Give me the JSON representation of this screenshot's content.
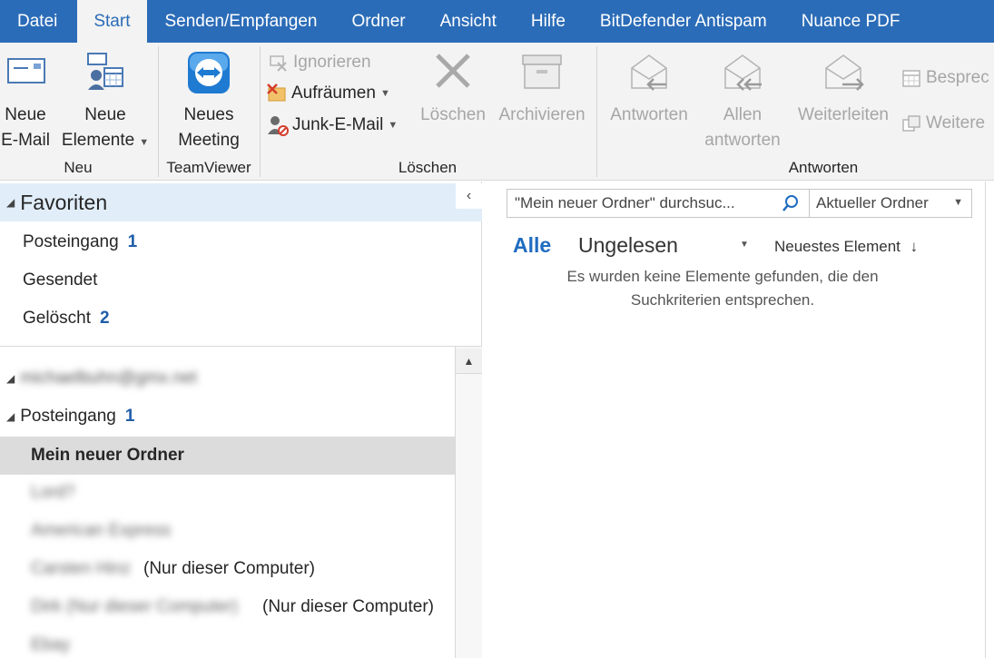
{
  "tabs": [
    "Datei",
    "Start",
    "Senden/Empfangen",
    "Ordner",
    "Ansicht",
    "Hilfe",
    "BitDefender Antispam",
    "Nuance PDF"
  ],
  "ribbon": {
    "neu": {
      "new_mail": [
        "Neue",
        "E-Mail"
      ],
      "new_items": [
        "Neue",
        "Elemente"
      ],
      "group": "Neu"
    },
    "teamviewer": {
      "meeting": [
        "Neues",
        "Meeting"
      ],
      "group": "TeamViewer"
    },
    "loeschen": {
      "ignore": "Ignorieren",
      "cleanup": "Aufräumen",
      "junk": "Junk-E-Mail",
      "delete": "Löschen",
      "archive": "Archivieren",
      "group": "Löschen"
    },
    "antworten": {
      "reply": "Antworten",
      "reply_all": [
        "Allen",
        "antworten"
      ],
      "forward": "Weiterleiten",
      "meeting": "Besprec",
      "more": "Weitere",
      "group": "Antworten"
    }
  },
  "nav": {
    "favorites_title": "Favoriten",
    "favorites": [
      {
        "label": "Posteingang",
        "count": "1"
      },
      {
        "label": "Gesendet",
        "count": ""
      },
      {
        "label": "Gelöscht",
        "count": "2"
      }
    ],
    "account": "michaelbuhn@gmx.net",
    "inbox": {
      "label": "Posteingang",
      "count": "1"
    },
    "selected_folder": "Mein neuer Ordner",
    "subfolders": [
      {
        "name": "Lord?",
        "suffix": ""
      },
      {
        "name": "American Express",
        "suffix": ""
      },
      {
        "name": "Carsten Hinz",
        "suffix": "(Nur dieser Computer)"
      },
      {
        "name": "Dirk (Nur dieser Computer)",
        "suffix": "(Nur dieser Computer)"
      },
      {
        "name": "Ebay",
        "suffix": ""
      }
    ]
  },
  "main": {
    "search_placeholder": "\"Mein neuer Ordner\" durchsuc...",
    "scope": "Aktueller Ordner",
    "filter_all": "Alle",
    "filter_unread": "Ungelesen",
    "sort": "Neuestes Element",
    "empty_line1": "Es wurden keine Elemente gefunden, die den",
    "empty_line2": "Suchkriterien entsprechen."
  },
  "colors": {
    "accent": "#2b6cb8",
    "ribbon_bg": "#f3f3f3",
    "favorites_bg": "#e1eef9",
    "selected_bg": "#dcdcdc",
    "count": "#1f5ea8"
  }
}
